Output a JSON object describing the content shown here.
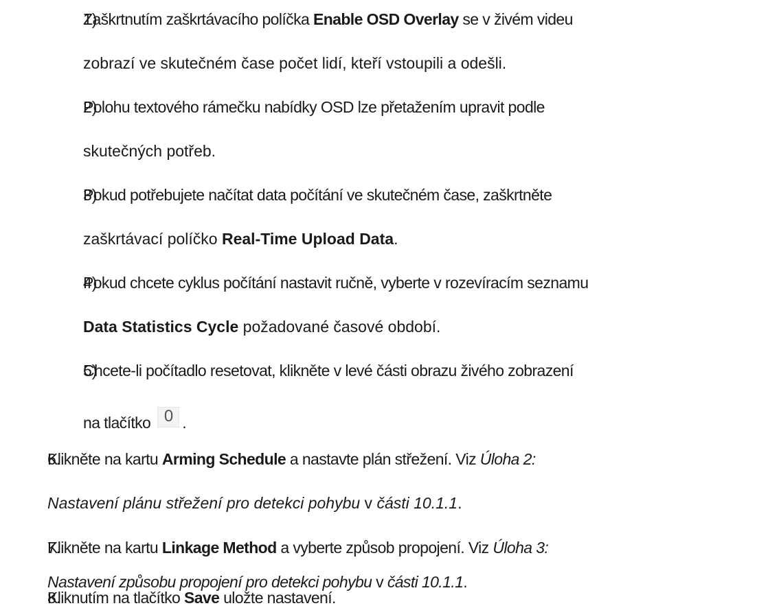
{
  "items": [
    {
      "num": "1)",
      "lines": [
        [
          "Zaškrtnutím zaškrtávacího políčka ",
          "Enable OSD Overlay",
          " se v živém videu"
        ],
        [
          "zobrazí ve skutečném čase počet lidí, kteří vstoupili a odešli."
        ]
      ]
    },
    {
      "num": "2)",
      "lines": [
        [
          "Polohu textového rámečku nabídky OSD lze přetažením upravit podle"
        ],
        [
          "skutečných potřeb."
        ]
      ]
    },
    {
      "num": "3)",
      "lines": [
        [
          "Pokud potřebujete načítat data počítání ve skutečném čase, zaškrtněte"
        ],
        [
          "zaškrtávací políčko ",
          "Real-Time Upload Data",
          "."
        ]
      ]
    },
    {
      "num": "4)",
      "lines": [
        [
          "Pokud chcete cyklus počítání nastavit ručně, vyberte v rozevíracím seznamu"
        ],
        [
          "Data Statistics Cycle",
          " požadované časové období."
        ]
      ]
    },
    {
      "num": "5)",
      "lines": [
        [
          "Chcete-li počítadlo resetovat, klikněte v levé části obrazu živého zobrazení"
        ],
        [
          "na tlačítko",
          "."
        ]
      ],
      "button_label": "0"
    },
    {
      "num": "6.",
      "lines": [
        [
          "Klikněte na kartu ",
          "Arming Schedule",
          " a nastavte plán střežení. Viz ",
          "Úloha 2:"
        ],
        [
          "Nastavení plánu střežení pro detekci pohybu",
          " v ",
          "části 10.1.1",
          "."
        ]
      ]
    },
    {
      "num": "7.",
      "lines": [
        [
          "Klikněte na kartu ",
          "Linkage Method",
          " a vyberte způsob propojení. Viz ",
          "Úloha 3:"
        ],
        [
          "Nastavení způsobu propojení pro detekci pohybu",
          " v ",
          "části 10.1.1",
          "."
        ]
      ]
    },
    {
      "num": "8.",
      "lines": [
        [
          "Kliknutím na tlačítko ",
          "Save",
          " uložte nastavení."
        ]
      ]
    }
  ]
}
